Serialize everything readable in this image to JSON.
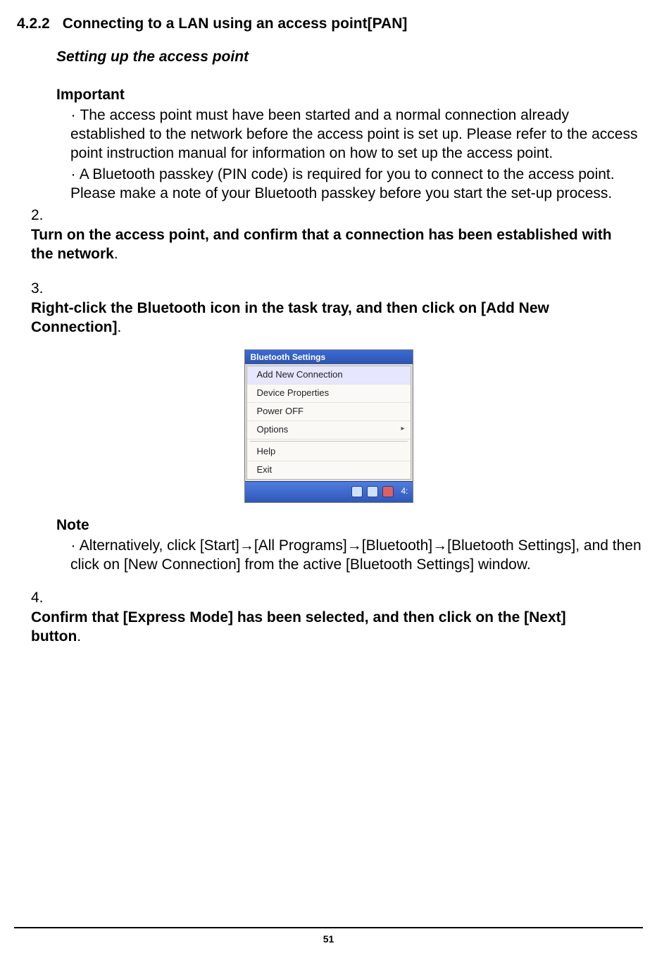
{
  "heading": {
    "number": "4.2.2",
    "title": "Connecting to a LAN using an access point[PAN]"
  },
  "subheading": "Setting up the access point",
  "important": {
    "label": "Important",
    "bullets": [
      "The access point must have been started and a normal connection already established to the network before the access point is set up. Please refer to the access point instruction manual for information on how to set up the access point.",
      "A Bluetooth passkey (PIN code) is required for you to connect to the access point. Please make a note of your Bluetooth passkey before you start the set-up process."
    ]
  },
  "steps": {
    "s2": {
      "num": "2.",
      "bold": "Turn on the access point, and confirm that a connection has been established with the network",
      "tail": "."
    },
    "s3": {
      "num": "3.",
      "bold": "Right-click the Bluetooth icon in the task tray, and then click on [Add New Connection]",
      "tail": "."
    },
    "s4": {
      "num": "4.",
      "bold": "Confirm that [Express Mode] has been selected, and then click on the [Next] button",
      "tail": "."
    }
  },
  "figure": {
    "header": "Bluetooth Settings",
    "items": {
      "addnew": "Add New Connection",
      "devprop": "Device Properties",
      "poweroff": "Power OFF",
      "options": "Options",
      "help": "Help",
      "exit": "Exit"
    },
    "clock": "4:"
  },
  "note": {
    "label": "Note",
    "text": "Alternatively, click [Start]→[All Programs]→[Bluetooth]→[Bluetooth Settings], and then click on [New Connection] from the active [Bluetooth Settings] window."
  },
  "page_number": "51"
}
